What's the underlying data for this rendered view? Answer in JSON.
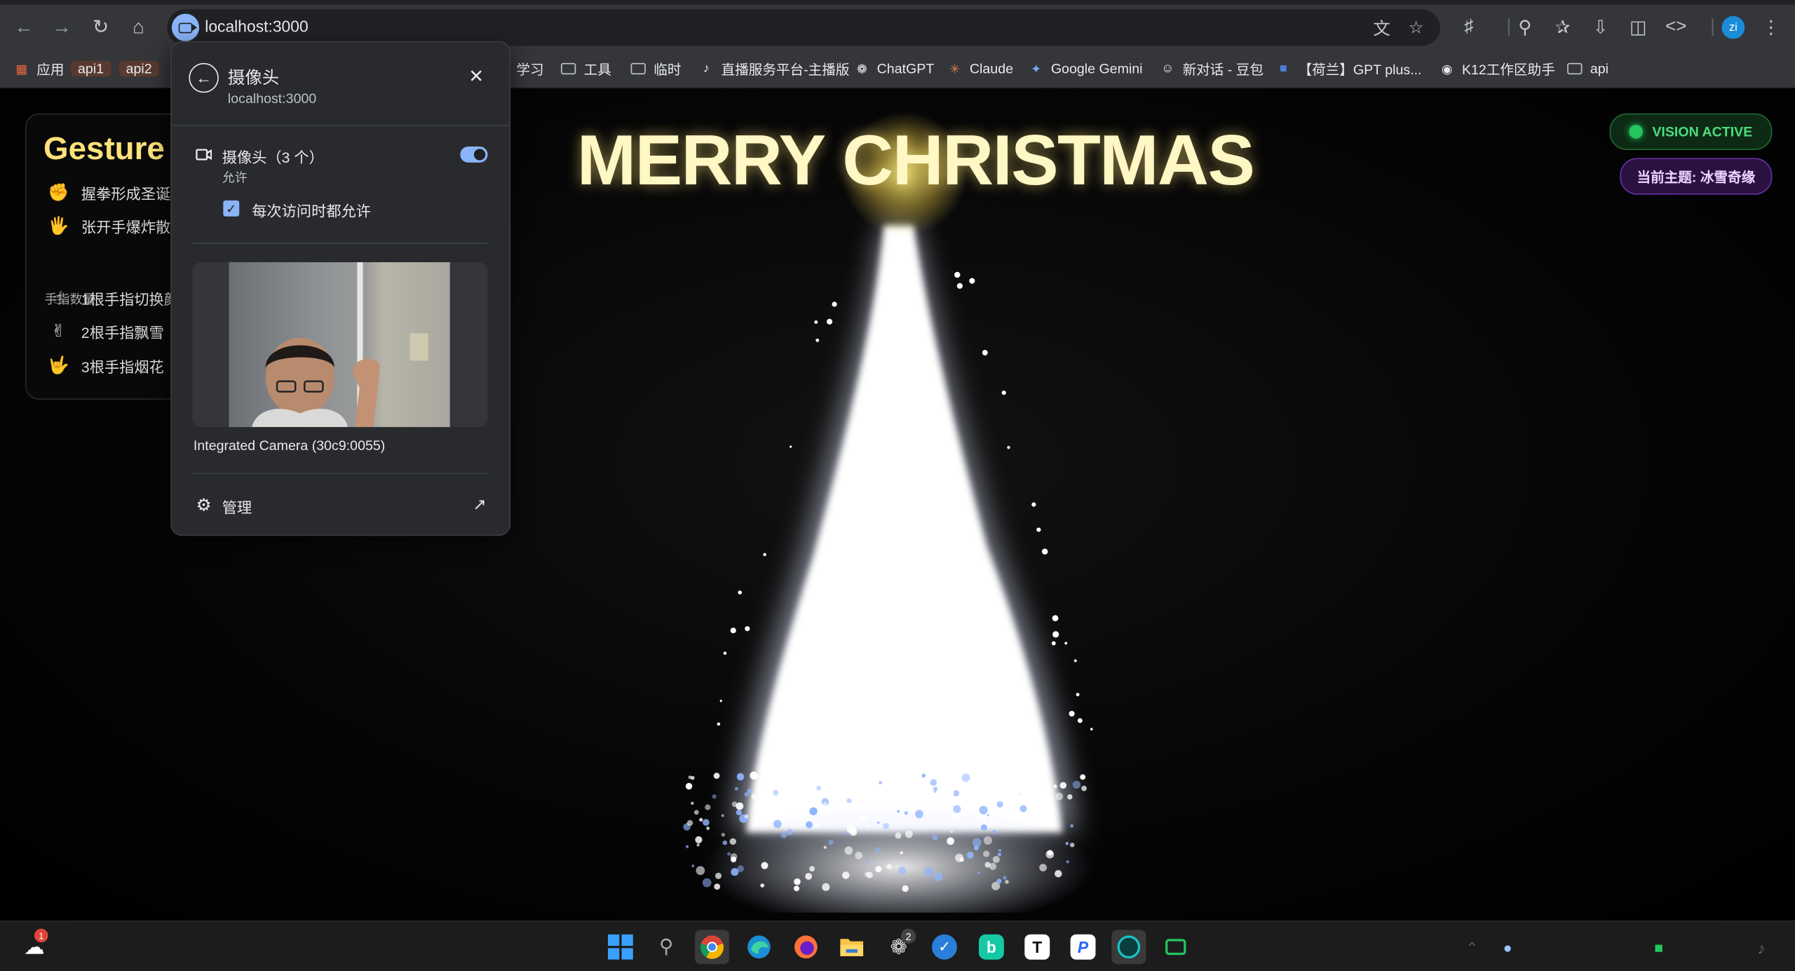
{
  "browser": {
    "url": "localhost:3000",
    "profile_initials": "zi",
    "bookmarks": [
      {
        "label": "应用",
        "icon": "apps-grid-icon"
      },
      {
        "label": "api1",
        "icon": "none"
      },
      {
        "label": "api2",
        "icon": "none"
      },
      {
        "label": "学习",
        "icon": "folder-icon"
      },
      {
        "label": "工具",
        "icon": "folder-icon"
      },
      {
        "label": "临时",
        "icon": "folder-icon"
      },
      {
        "label": "直播服务平台-主播版",
        "icon": "tiktok-icon"
      },
      {
        "label": "ChatGPT",
        "icon": "openai-icon"
      },
      {
        "label": "Claude",
        "icon": "claude-icon"
      },
      {
        "label": "Google Gemini",
        "icon": "gemini-icon"
      },
      {
        "label": "新对话 - 豆包",
        "icon": "doubao-icon"
      },
      {
        "label": "【荷兰】GPT plus...",
        "icon": "site-icon"
      },
      {
        "label": "K12工作区助手",
        "icon": "globe-icon"
      },
      {
        "label": "api",
        "icon": "folder-icon"
      }
    ]
  },
  "page": {
    "gesture_title": "Gesture",
    "gestures": [
      {
        "emoji": "✊",
        "text": "握拳形成圣诞"
      },
      {
        "emoji": "🖐",
        "text": "张开手爆炸散"
      }
    ],
    "finger_count_label": "手指数量:",
    "finger_gestures": [
      {
        "emoji": "☝",
        "text": "1根手指切换颜"
      },
      {
        "emoji": "✌",
        "text": "2根手指飘雪"
      },
      {
        "emoji": "🤟",
        "text": "3根手指烟花"
      }
    ],
    "headline": "MERRY CHRISTMAS",
    "vision_status": "VISION ACTIVE",
    "theme_label": "当前主题: 冰雪奇缘",
    "colors": {
      "headline": "#fff7c4",
      "vision": "#4ade80",
      "theme": "#e9d5ff"
    }
  },
  "popup": {
    "title": "摄像头",
    "origin": "localhost:3000",
    "camera_label": "摄像头（3 个）",
    "camera_status": "允许",
    "always_allow_label": "每次访问时都允许",
    "always_allow_checked": true,
    "camera_enabled": true,
    "camera_device": "Integrated Camera (30c9:0055)",
    "manage_label": "管理"
  },
  "taskbar": {
    "notification_badge": "1",
    "app_badge": "2"
  }
}
